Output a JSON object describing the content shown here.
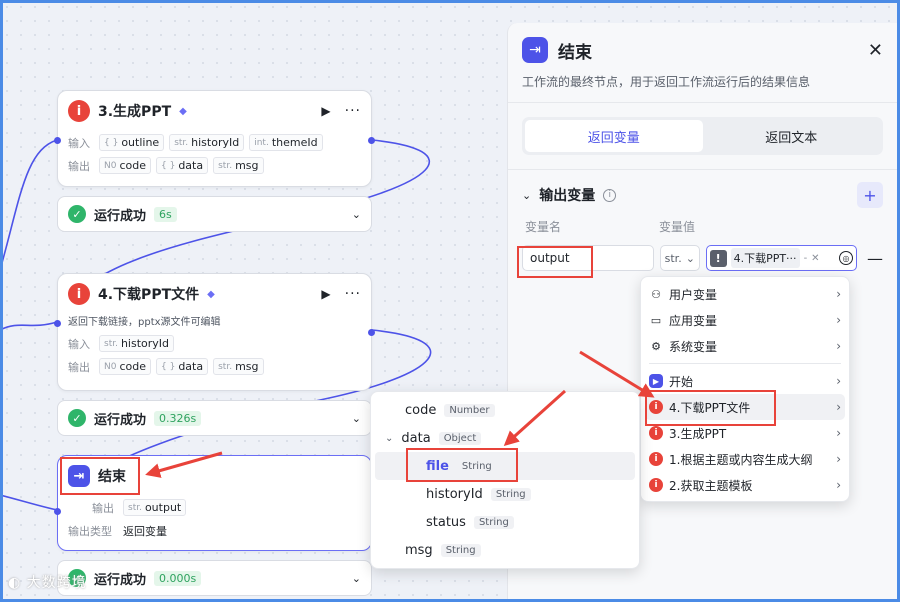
{
  "nodes": {
    "generate_ppt": {
      "icon": "i",
      "title": "3.生成PPT",
      "input_label": "输入",
      "inputs": [
        {
          "type": "{ }",
          "name": "outline"
        },
        {
          "type": "str.",
          "name": "historyId"
        },
        {
          "type": "int.",
          "name": "themeId"
        }
      ],
      "output_label": "输出",
      "outputs": [
        {
          "type": "N0",
          "name": "code"
        },
        {
          "type": "{ }",
          "name": "data"
        },
        {
          "type": "str.",
          "name": "msg"
        }
      ],
      "status": "运行成功",
      "time": "6s"
    },
    "download_ppt": {
      "icon": "i",
      "title": "4.下载PPT文件",
      "desc": "返回下载链接，pptx源文件可编辑",
      "input_label": "输入",
      "inputs": [
        {
          "type": "str.",
          "name": "historyId"
        }
      ],
      "output_label": "输出",
      "outputs": [
        {
          "type": "N0",
          "name": "code"
        },
        {
          "type": "{ }",
          "name": "data"
        },
        {
          "type": "str.",
          "name": "msg"
        }
      ],
      "status": "运行成功",
      "time": "0.326s"
    },
    "end": {
      "title": "结束",
      "output_label": "输出",
      "outputs": [
        {
          "type": "str.",
          "name": "output"
        }
      ],
      "output_type_label": "输出类型",
      "output_type_value": "返回变量",
      "status": "运行成功",
      "time": "0.000s"
    }
  },
  "panel": {
    "title": "结束",
    "desc": "工作流的最终节点，用于返回工作流运行后的结果信息",
    "tabs": [
      "返回变量",
      "返回文本"
    ],
    "active_tab": 0,
    "section_title": "输出变量",
    "col_name": "变量名",
    "col_value": "变量值",
    "var_name": "output",
    "var_type": "str.",
    "ref_text": "4.下载PPT···",
    "ref_sep": "-"
  },
  "var_menu": {
    "groups": [
      {
        "icon": "user-icon",
        "label": "用户变量"
      },
      {
        "icon": "folder-icon",
        "label": "应用变量"
      },
      {
        "icon": "gear-icon",
        "label": "系统变量"
      }
    ],
    "nodes": [
      {
        "icon": "start",
        "label": "开始"
      },
      {
        "icon": "info",
        "label": "4.下载PPT文件"
      },
      {
        "icon": "info",
        "label": "3.生成PPT"
      },
      {
        "icon": "info",
        "label": "1.根据主题或内容生成大纲"
      },
      {
        "icon": "info",
        "label": "2.获取主题模板"
      }
    ]
  },
  "field_menu": {
    "items": [
      {
        "name": "code",
        "type": "Number",
        "level": 0
      },
      {
        "name": "data",
        "type": "Object",
        "level": 0,
        "expanded": true
      },
      {
        "name": "file",
        "type": "String",
        "level": 1,
        "selected": true
      },
      {
        "name": "historyId",
        "type": "String",
        "level": 1
      },
      {
        "name": "status",
        "type": "String",
        "level": 1
      },
      {
        "name": "msg",
        "type": "String",
        "level": 0
      }
    ]
  },
  "watermark": "大数跨境",
  "colors": {
    "accent": "#4d53e8",
    "success": "#2fb56a",
    "annotation": "#e8433a",
    "frame": "#4b8be6"
  }
}
